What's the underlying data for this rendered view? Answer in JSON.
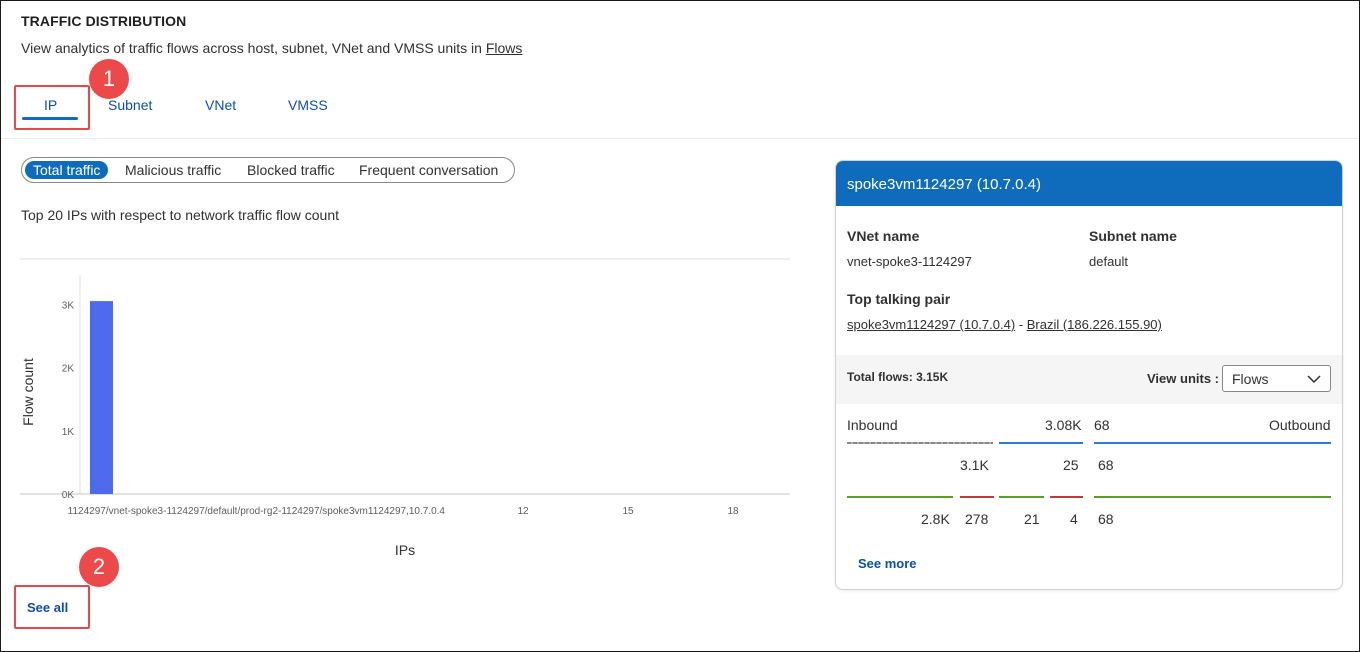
{
  "section": {
    "title": "TRAFFIC DISTRIBUTION",
    "subtitle_prefix": "View analytics of traffic flows across host, subnet, VNet and VMSS units in ",
    "subtitle_link": "Flows"
  },
  "tabs": [
    {
      "label": "IP",
      "active": true
    },
    {
      "label": "Subnet",
      "active": false
    },
    {
      "label": "VNet",
      "active": false
    },
    {
      "label": "VMSS",
      "active": false
    }
  ],
  "annotations": [
    "1",
    "2"
  ],
  "filters": [
    {
      "label": "Total traffic",
      "active": true
    },
    {
      "label": "Malicious traffic",
      "active": false
    },
    {
      "label": "Blocked traffic",
      "active": false
    },
    {
      "label": "Frequent conversation",
      "active": false
    }
  ],
  "chart_caption": "Top 20 IPs with respect to network traffic flow count",
  "chart_data": {
    "type": "bar",
    "title": "",
    "xlabel": "IPs",
    "ylabel": "Flow count",
    "y_ticks": [
      "0K",
      "1K",
      "2K",
      "3K"
    ],
    "ylim": [
      0,
      3700
    ],
    "x_tick_labels": [
      "1124297/vnet-spoke3-1124297/default/prod-rg2-1124297/spoke3vm1124297,10.7.0.4",
      "12",
      "15",
      "18"
    ],
    "categories": [
      "1124297/vnet-spoke3-1124297/default/prod-rg2-1124297/spoke3vm1124297,10.7.0.4"
    ],
    "values": [
      3050
    ],
    "grid": false,
    "bar_color": "#4f6bed"
  },
  "see_all_label": "See all",
  "detail": {
    "header": "spoke3vm1124297 (10.7.0.4)",
    "vnet_label": "VNet name",
    "vnet_value": "vnet-spoke3-1124297",
    "subnet_label": "Subnet name",
    "subnet_value": "default",
    "pair_label": "Top talking pair",
    "pair_left": "spoke3vm1124297 (10.7.0.4)",
    "pair_sep": " - ",
    "pair_right": "Brazil (186.226.155.90)",
    "total_flows": "Total flows: 3.15K",
    "view_units_label": "View units :",
    "view_units_value": "Flows",
    "inbound_label": "Inbound",
    "outbound_label": "Outbound",
    "row1": {
      "left": "3.08K",
      "right": "68"
    },
    "row2": {
      "a": "3.1K",
      "b": "25",
      "c": "68"
    },
    "row3": {
      "a": "2.8K",
      "b": "278",
      "c": "21",
      "d": "4",
      "e": "68"
    },
    "see_more": "See more"
  },
  "colors": {
    "accent": "#0f6cbd",
    "annotation": "#ec4a4a",
    "inbound_gray": "#8a8886",
    "blue_line": "#2b7cd3",
    "green_line": "#5a9e29",
    "red_line": "#c0393b"
  }
}
